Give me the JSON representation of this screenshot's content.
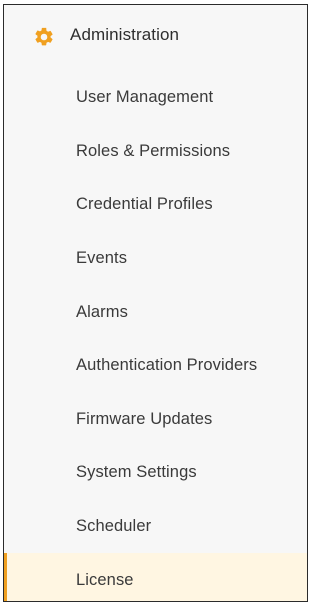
{
  "section": {
    "title": "Administration",
    "icon": "gear-icon",
    "icon_color": "#f0a020"
  },
  "menu": {
    "items": [
      {
        "label": "User Management"
      },
      {
        "label": "Roles & Permissions"
      },
      {
        "label": "Credential Profiles"
      },
      {
        "label": "Events"
      },
      {
        "label": "Alarms"
      },
      {
        "label": "Authentication Providers"
      },
      {
        "label": "Firmware Updates"
      },
      {
        "label": "System Settings"
      },
      {
        "label": "Scheduler"
      },
      {
        "label": "License",
        "active": true
      }
    ],
    "active_background": "#fff6e2",
    "active_indicator_color": "#f0a020"
  }
}
